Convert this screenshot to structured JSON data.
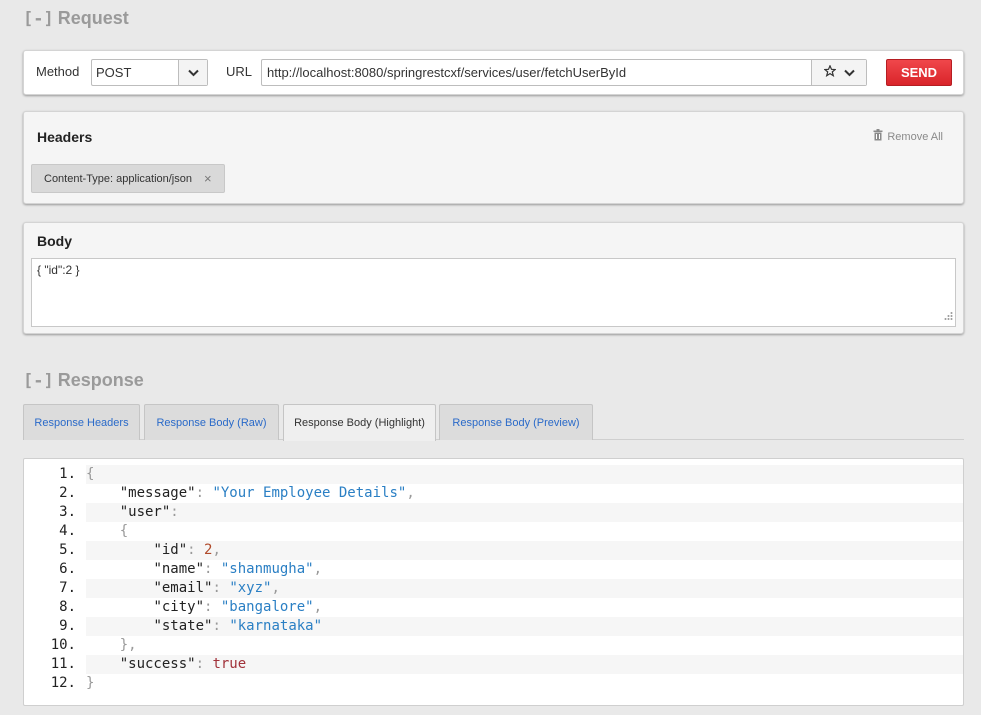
{
  "request": {
    "toggle": "[-]",
    "title": "Request",
    "method_label": "Method",
    "method_value": "POST",
    "url_label": "URL",
    "url_value": "http://localhost:8080/springrestcxf/services/user/fetchUserById",
    "send_label": "SEND"
  },
  "headers": {
    "title": "Headers",
    "remove_all_label": "Remove All",
    "items": [
      {
        "label": "Content-Type: application/json",
        "remove": "×"
      }
    ]
  },
  "body": {
    "title": "Body",
    "value": "{ \"id\":2 }"
  },
  "response": {
    "toggle": "[-]",
    "title": "Response",
    "tabs": [
      {
        "label": "Response Headers"
      },
      {
        "label": "Response Body (Raw)"
      },
      {
        "label": "Response Body (Highlight)"
      },
      {
        "label": "Response Body (Preview)"
      }
    ],
    "active_tab": "Response Body (Highlight)",
    "code": [
      {
        "n": "1.",
        "tokens": [
          [
            "p",
            "{"
          ]
        ]
      },
      {
        "n": "2.",
        "tokens": [
          [
            "s",
            "    "
          ],
          [
            "k",
            "\"message\""
          ],
          [
            "p",
            ": "
          ],
          [
            "str",
            "\"Your Employee Details\""
          ],
          [
            "p",
            ","
          ]
        ]
      },
      {
        "n": "3.",
        "tokens": [
          [
            "s",
            "    "
          ],
          [
            "k",
            "\"user\""
          ],
          [
            "p",
            ":"
          ]
        ]
      },
      {
        "n": "4.",
        "tokens": [
          [
            "s",
            "    "
          ],
          [
            "p",
            "{"
          ]
        ]
      },
      {
        "n": "5.",
        "tokens": [
          [
            "s",
            "        "
          ],
          [
            "k",
            "\"id\""
          ],
          [
            "p",
            ": "
          ],
          [
            "num",
            "2"
          ],
          [
            "p",
            ","
          ]
        ]
      },
      {
        "n": "6.",
        "tokens": [
          [
            "s",
            "        "
          ],
          [
            "k",
            "\"name\""
          ],
          [
            "p",
            ": "
          ],
          [
            "str",
            "\"shanmugha\""
          ],
          [
            "p",
            ","
          ]
        ]
      },
      {
        "n": "7.",
        "tokens": [
          [
            "s",
            "        "
          ],
          [
            "k",
            "\"email\""
          ],
          [
            "p",
            ": "
          ],
          [
            "str",
            "\"xyz\""
          ],
          [
            "p",
            ","
          ]
        ]
      },
      {
        "n": "8.",
        "tokens": [
          [
            "s",
            "        "
          ],
          [
            "k",
            "\"city\""
          ],
          [
            "p",
            ": "
          ],
          [
            "str",
            "\"bangalore\""
          ],
          [
            "p",
            ","
          ]
        ]
      },
      {
        "n": "9.",
        "tokens": [
          [
            "s",
            "        "
          ],
          [
            "k",
            "\"state\""
          ],
          [
            "p",
            ": "
          ],
          [
            "str",
            "\"karnataka\""
          ]
        ]
      },
      {
        "n": "10.",
        "tokens": [
          [
            "s",
            "    "
          ],
          [
            "p",
            "},"
          ]
        ]
      },
      {
        "n": "11.",
        "tokens": [
          [
            "s",
            "    "
          ],
          [
            "k",
            "\"success\""
          ],
          [
            "p",
            ": "
          ],
          [
            "bool",
            "true"
          ]
        ]
      },
      {
        "n": "12.",
        "tokens": [
          [
            "p",
            "}"
          ]
        ]
      }
    ]
  },
  "colors": {
    "send_button": "#e0313a",
    "string": "#2a7fc4",
    "number": "#b04a2a",
    "boolean": "#a1323a",
    "tab_link": "#2a6ac9"
  },
  "icons": {
    "method_dropdown": "chevron-down-icon",
    "favorite": "star-icon",
    "url_dropdown": "chevron-down-icon",
    "remove_all": "trash-icon",
    "chip_remove": "close-icon",
    "resize": "resize-grip-icon"
  }
}
